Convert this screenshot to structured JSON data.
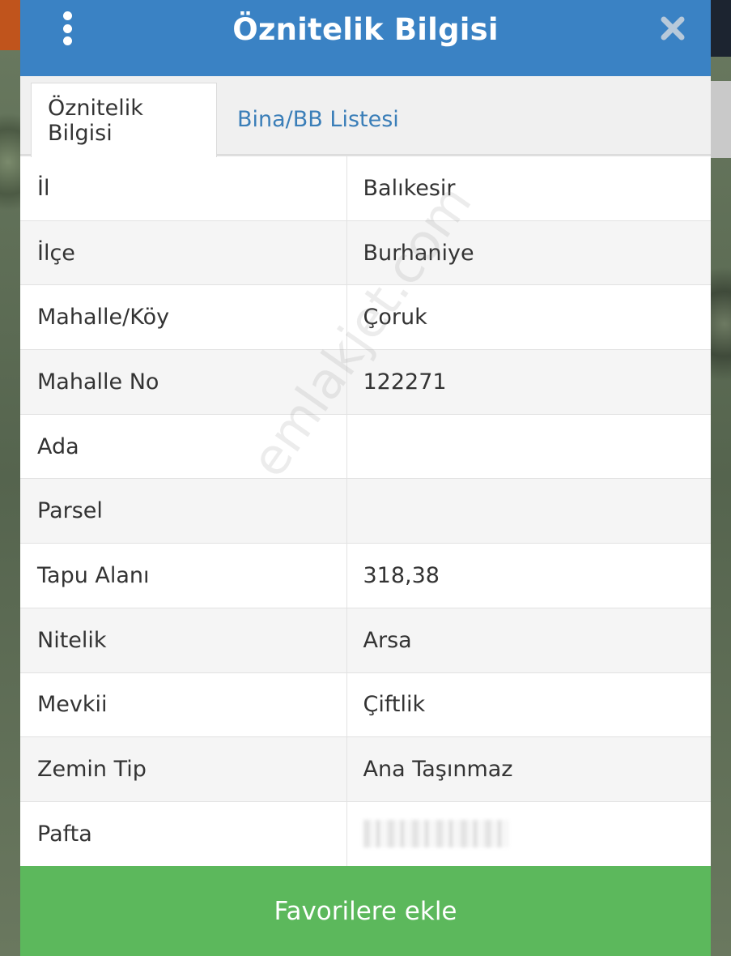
{
  "header": {
    "title": "Öznitelik Bilgisi"
  },
  "tabs": [
    {
      "label": "Öznitelik Bilgisi",
      "active": true
    },
    {
      "label": "Bina/BB Listesi",
      "active": false
    }
  ],
  "attributes": [
    {
      "key": "İl",
      "value": "Balıkesir"
    },
    {
      "key": "İlçe",
      "value": "Burhaniye"
    },
    {
      "key": "Mahalle/Köy",
      "value": "Çoruk"
    },
    {
      "key": "Mahalle No",
      "value": "122271"
    },
    {
      "key": "Ada",
      "value": ""
    },
    {
      "key": "Parsel",
      "value": ""
    },
    {
      "key": "Tapu Alanı",
      "value": "318,38"
    },
    {
      "key": "Nitelik",
      "value": "Arsa"
    },
    {
      "key": "Mevkii",
      "value": "Çiftlik"
    },
    {
      "key": "Zemin Tip",
      "value": "Ana Taşınmaz"
    },
    {
      "key": "Pafta",
      "value": ""
    }
  ],
  "watermark": "emlakjet.com",
  "footer": {
    "favorite_label": "Favorilere ekle"
  },
  "colors": {
    "header": "#3a82c4",
    "tab_link": "#3a7eb8",
    "button": "#5cb85c"
  },
  "icons": {
    "menu": "kebab-menu-icon",
    "close": "close-icon"
  }
}
